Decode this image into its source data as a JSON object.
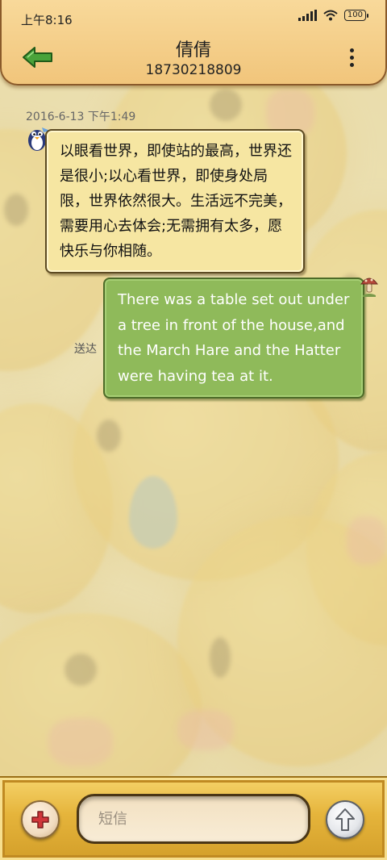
{
  "status_bar": {
    "time": "上午8:16",
    "battery": "100"
  },
  "header": {
    "contact_name": "倩倩",
    "phone_number": "18730218809"
  },
  "conversation": {
    "timestamp": "2016-6-13 下午1:49",
    "messages": [
      {
        "direction": "incoming",
        "text": "以眼看世界，即使站的最高，世界还是很小;以心看世界，即使身处局限，世界依然很大。生活远不完美，需要用心去体会;无需拥有太多，愿快乐与你相随。"
      },
      {
        "direction": "outgoing",
        "text": "There was a table set out under a tree in front of the house,and the March Hare and the Hatter were having tea at it.",
        "status": "送达"
      }
    ]
  },
  "composer": {
    "placeholder": "短信"
  },
  "colors": {
    "header": "#f1c57b",
    "incoming_bubble": "#f6e6a2",
    "outgoing_bubble": "#8fba5a",
    "input_bar": "#e5b43b"
  }
}
